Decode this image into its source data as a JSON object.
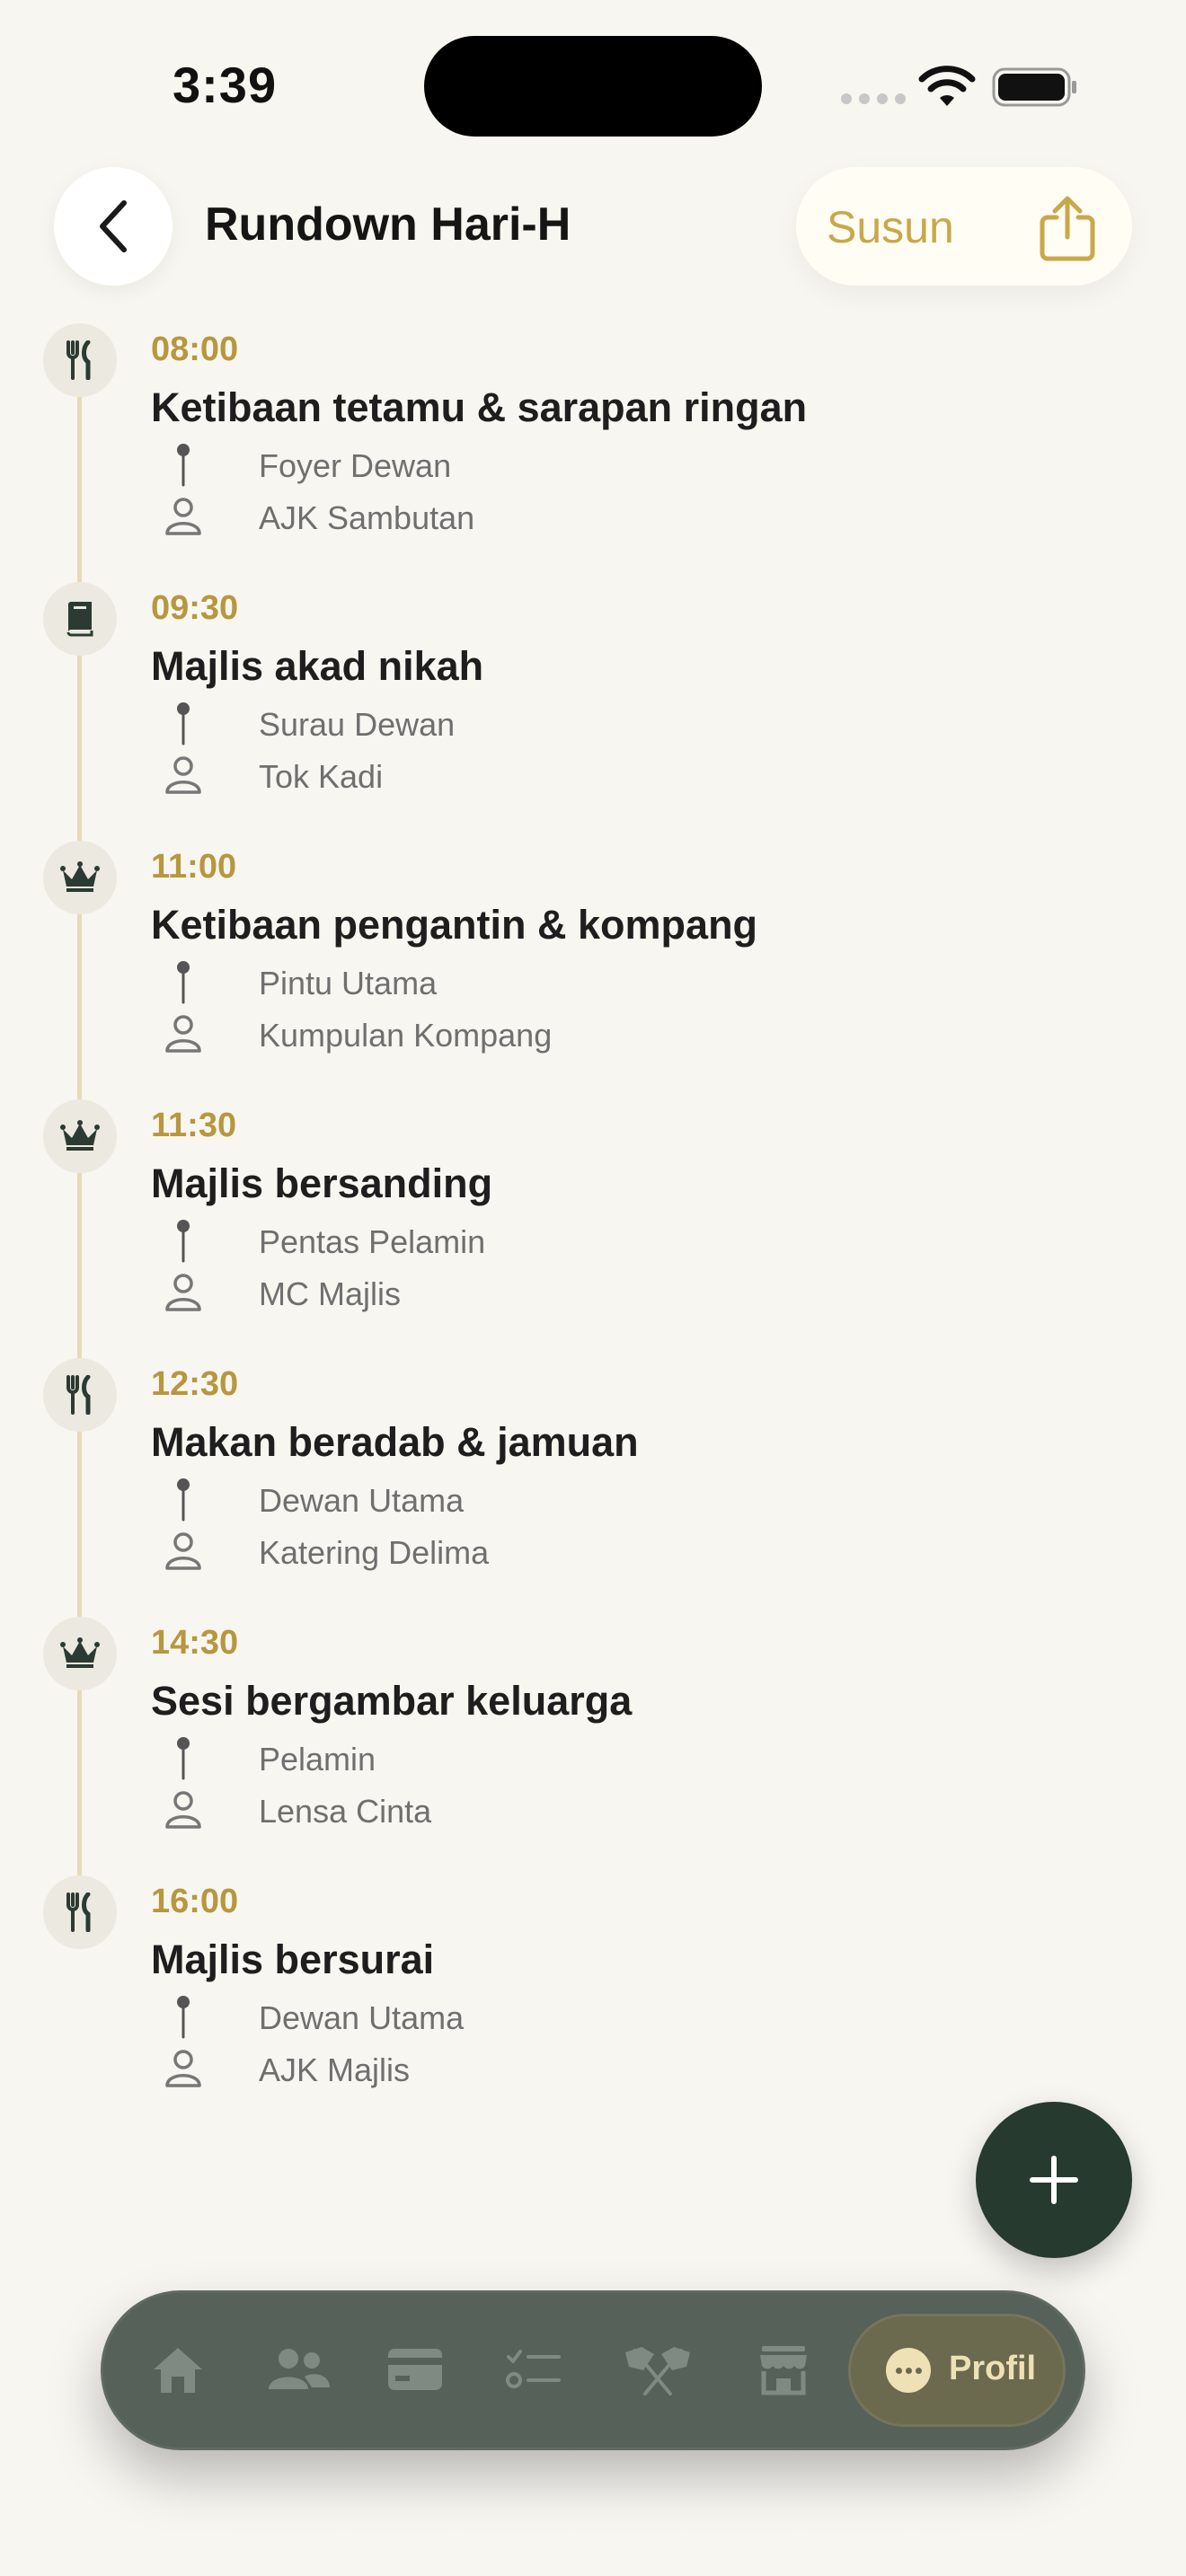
{
  "status_bar": {
    "time": "3:39"
  },
  "header": {
    "title": "Rundown Hari-H",
    "reorder_label": "Susun"
  },
  "colors": {
    "accent_gold": "#b7973f",
    "dark_green": "#263a2f",
    "background": "#f8f6f1"
  },
  "events": [
    {
      "icon": "utensils-icon",
      "time": "08:00",
      "title": "Ketibaan tetamu & sarapan ringan",
      "location": "Foyer Dewan",
      "person": "AJK Sambutan"
    },
    {
      "icon": "book-icon",
      "time": "09:30",
      "title": "Majlis akad nikah",
      "location": "Surau Dewan",
      "person": "Tok Kadi"
    },
    {
      "icon": "crown-icon",
      "time": "11:00",
      "title": "Ketibaan pengantin & kompang",
      "location": "Pintu Utama",
      "person": "Kumpulan Kompang"
    },
    {
      "icon": "crown-icon",
      "time": "11:30",
      "title": "Majlis bersanding",
      "location": "Pentas Pelamin",
      "person": "MC Majlis"
    },
    {
      "icon": "utensils-icon",
      "time": "12:30",
      "title": "Makan beradab & jamuan",
      "location": "Dewan Utama",
      "person": "Katering Delima"
    },
    {
      "icon": "crown-icon",
      "time": "14:30",
      "title": "Sesi bergambar keluarga",
      "location": "Pelamin",
      "person": "Lensa Cinta"
    },
    {
      "icon": "utensils-icon",
      "time": "16:00",
      "title": "Majlis bersurai",
      "location": "Dewan Utama",
      "person": "AJK Majlis"
    }
  ],
  "bottom_nav": {
    "items": [
      {
        "icon": "home-icon"
      },
      {
        "icon": "users-icon"
      },
      {
        "icon": "card-icon"
      },
      {
        "icon": "checklist-icon"
      },
      {
        "icon": "flags-icon"
      },
      {
        "icon": "store-icon"
      }
    ],
    "active": {
      "icon": "more-icon",
      "label": "Profil"
    }
  }
}
